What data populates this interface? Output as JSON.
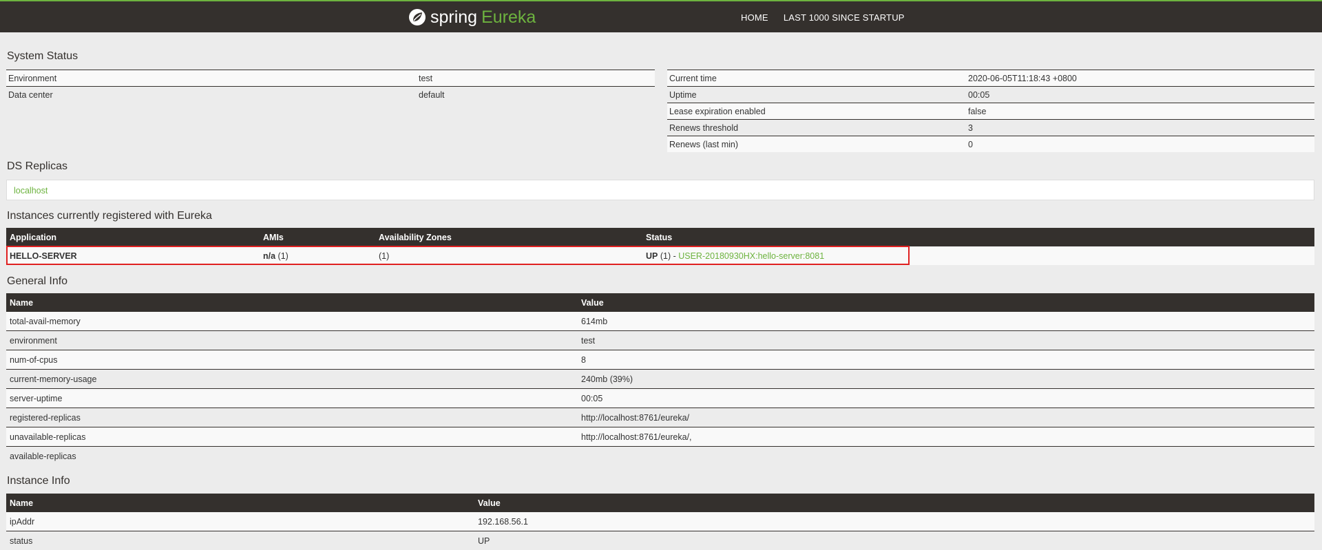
{
  "header": {
    "brand_word1": "spring",
    "brand_word2": "Eureka",
    "nav": [
      "HOME",
      "LAST 1000 SINCE STARTUP"
    ]
  },
  "system_status": {
    "title": "System Status",
    "left": [
      {
        "label": "Environment",
        "value": "test"
      },
      {
        "label": "Data center",
        "value": "default"
      }
    ],
    "right": [
      {
        "label": "Current time",
        "value": "2020-06-05T11:18:43 +0800"
      },
      {
        "label": "Uptime",
        "value": "00:05"
      },
      {
        "label": "Lease expiration enabled",
        "value": "false"
      },
      {
        "label": "Renews threshold",
        "value": "3"
      },
      {
        "label": "Renews (last min)",
        "value": "0"
      }
    ]
  },
  "ds_replicas": {
    "title": "DS Replicas",
    "items": [
      "localhost"
    ]
  },
  "instances": {
    "title": "Instances currently registered with Eureka",
    "headers": [
      "Application",
      "AMIs",
      "Availability Zones",
      "Status"
    ],
    "rows": [
      {
        "application": "HELLO-SERVER",
        "amis_bold": "n/a",
        "amis_count": " (1)",
        "zones": "(1)",
        "status_prefix": "UP",
        "status_count": " (1) - ",
        "status_link": "USER-20180930HX:hello-server:8081"
      }
    ]
  },
  "general_info": {
    "title": "General Info",
    "headers": [
      "Name",
      "Value"
    ],
    "rows": [
      {
        "name": "total-avail-memory",
        "value": "614mb"
      },
      {
        "name": "environment",
        "value": "test"
      },
      {
        "name": "num-of-cpus",
        "value": "8"
      },
      {
        "name": "current-memory-usage",
        "value": "240mb (39%)"
      },
      {
        "name": "server-uptime",
        "value": "00:05"
      },
      {
        "name": "registered-replicas",
        "value": "http://localhost:8761/eureka/"
      },
      {
        "name": "unavailable-replicas",
        "value": "http://localhost:8761/eureka/,"
      },
      {
        "name": "available-replicas",
        "value": ""
      }
    ]
  },
  "instance_info": {
    "title": "Instance Info",
    "headers": [
      "Name",
      "Value"
    ],
    "rows": [
      {
        "name": "ipAddr",
        "value": "192.168.56.1"
      },
      {
        "name": "status",
        "value": "UP"
      }
    ]
  },
  "colors": {
    "accent": "#6db33f",
    "dark": "#34302d",
    "highlight": "#e02020"
  }
}
